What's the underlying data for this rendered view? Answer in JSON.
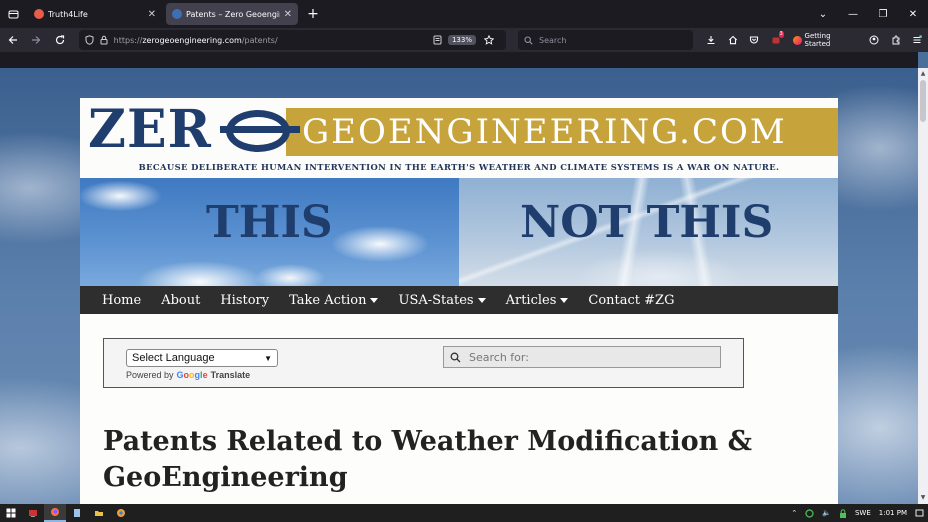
{
  "browser": {
    "tabs": [
      {
        "label": "Truth4Life",
        "active": false,
        "favicon_color": "#e85c4a"
      },
      {
        "label": "Patents – Zero Geoengineering",
        "active": true,
        "favicon_color": "#3d6fb5"
      }
    ],
    "url_host": "zerogeoengineering.com",
    "url_prefix": "https://",
    "url_path": "/patents/",
    "zoom": "133%",
    "search_placeholder": "Search",
    "getting_started": "Getting Started",
    "badge_count": "3"
  },
  "site": {
    "logo_zero": "ZER",
    "logo_domain": "GEOENGINEERING.COM",
    "tagline": "BECAUSE DELIBERATE HUMAN INTERVENTION IN THE EARTH'S WEATHER AND CLIMATE SYSTEMS IS A WAR ON NATURE.",
    "this_label": "THIS",
    "not_this_label": "NOT THIS",
    "menu": [
      {
        "label": "Home",
        "dropdown": false
      },
      {
        "label": "About",
        "dropdown": false
      },
      {
        "label": "History",
        "dropdown": false
      },
      {
        "label": "Take Action",
        "dropdown": true
      },
      {
        "label": "USA-States",
        "dropdown": true
      },
      {
        "label": "Articles",
        "dropdown": true
      },
      {
        "label": "Contact #ZG",
        "dropdown": false
      }
    ],
    "language_select": "Select Language",
    "powered_by": "Powered by",
    "google_letters": [
      "G",
      "o",
      "o",
      "g",
      "l",
      "e"
    ],
    "translate": "Translate",
    "search_placeholder": "Search for:",
    "heading": "Patents Related to Weather Modification & GeoEngineering"
  },
  "taskbar": {
    "language": "SWE",
    "time": "1:01 PM"
  }
}
